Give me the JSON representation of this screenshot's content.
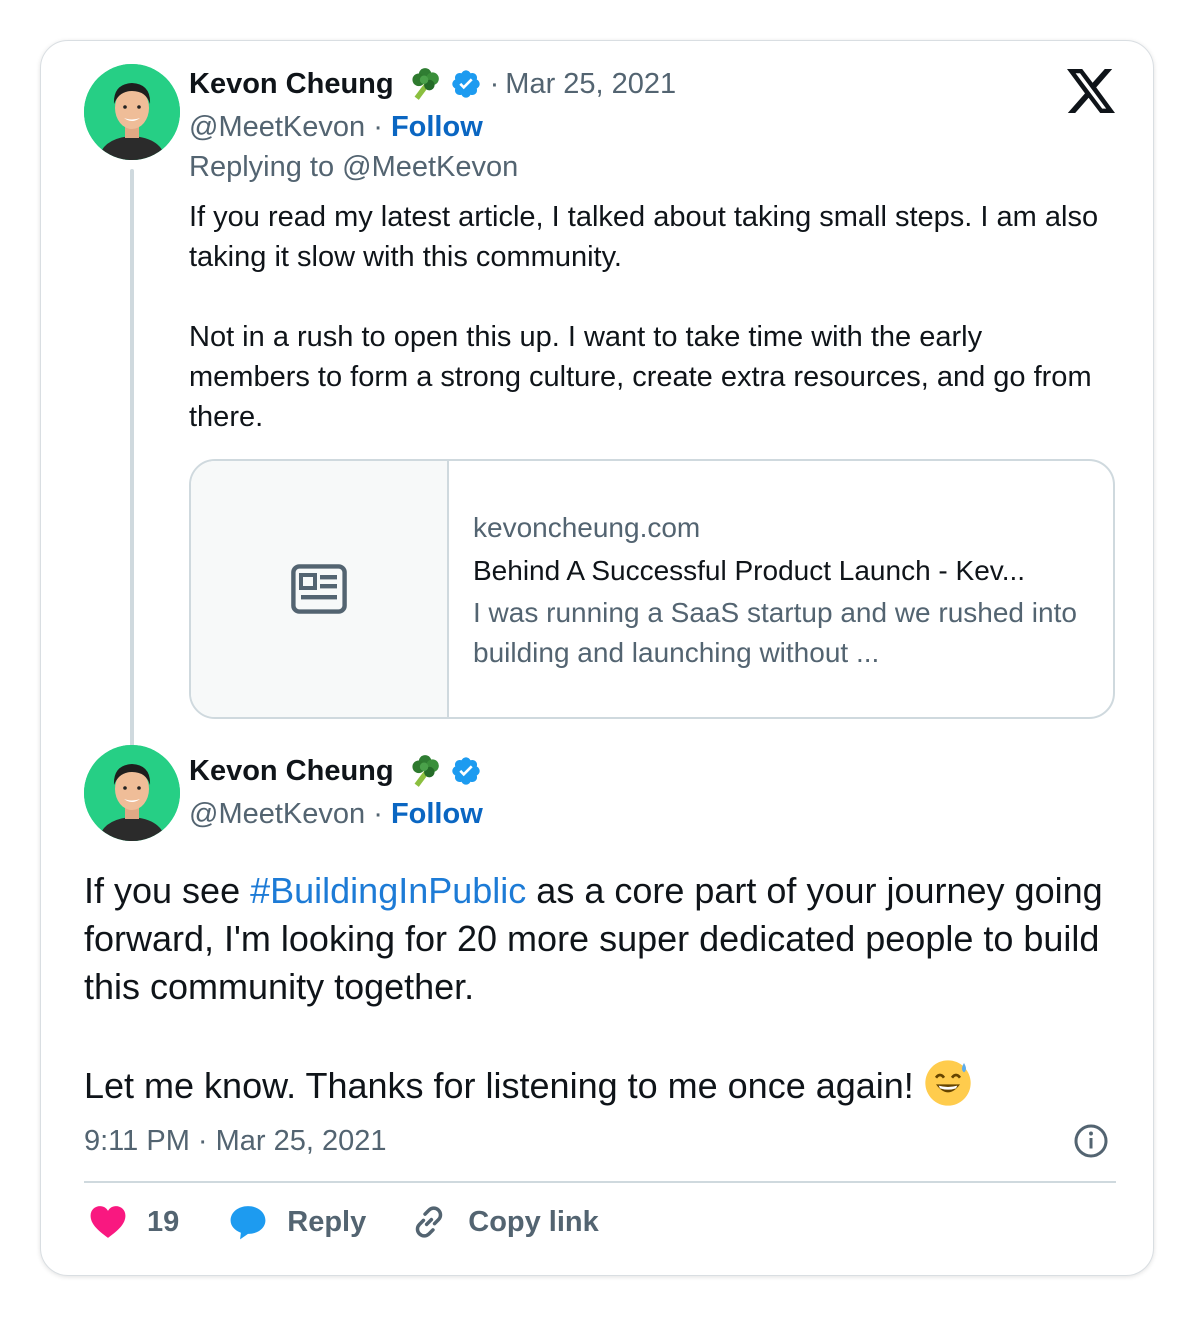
{
  "tweet1": {
    "author_name": "Kevon Cheung",
    "handle": "@MeetKevon",
    "separator": "·",
    "date": "Mar 25, 2021",
    "follow_label": "Follow",
    "replying_to": "Replying to @MeetKevon",
    "paragraphs": [
      "If you read my latest article, I talked about taking small steps. I am also taking it slow with this community.",
      "Not in a rush to open this up. I want to take time with the early members to form a strong culture, create extra resources, and go from there."
    ],
    "link_card": {
      "domain": "kevoncheung.com",
      "title": "Behind A Successful Product Launch - Kev...",
      "description": "I was running a SaaS startup and we rushed into building and launching without ..."
    }
  },
  "tweet2": {
    "author_name": "Kevon Cheung",
    "handle": "@MeetKevon",
    "separator": "·",
    "follow_label": "Follow",
    "text_before_hashtag": "If you see ",
    "hashtag": "#BuildingInPublic",
    "text_after_hashtag": " as a core part of your journey going forward, I'm looking for 20 more super dedicated people to build this community together.",
    "paragraph2": "Let me know. Thanks for listening to me once again! ",
    "timestamp": "9:11 PM · Mar 25, 2021"
  },
  "actions": {
    "like_count": "19",
    "reply_label": "Reply",
    "copy_link_label": "Copy link"
  },
  "icons": {
    "brand": "x-logo",
    "like": "heart-icon",
    "reply": "speech-bubble-icon",
    "copy": "link-icon",
    "info": "info-icon",
    "verified": "verified-badge-icon",
    "name_emoji": "broccoli-emoji",
    "end_emoji": "grinning-sweat-emoji"
  },
  "colors": {
    "follow": "#0a66c2",
    "hashtag": "#1d7bd6",
    "verified": "#1d9bf0",
    "like": "#f91880",
    "reply": "#1d9bf0",
    "secondary_text": "#536471"
  }
}
